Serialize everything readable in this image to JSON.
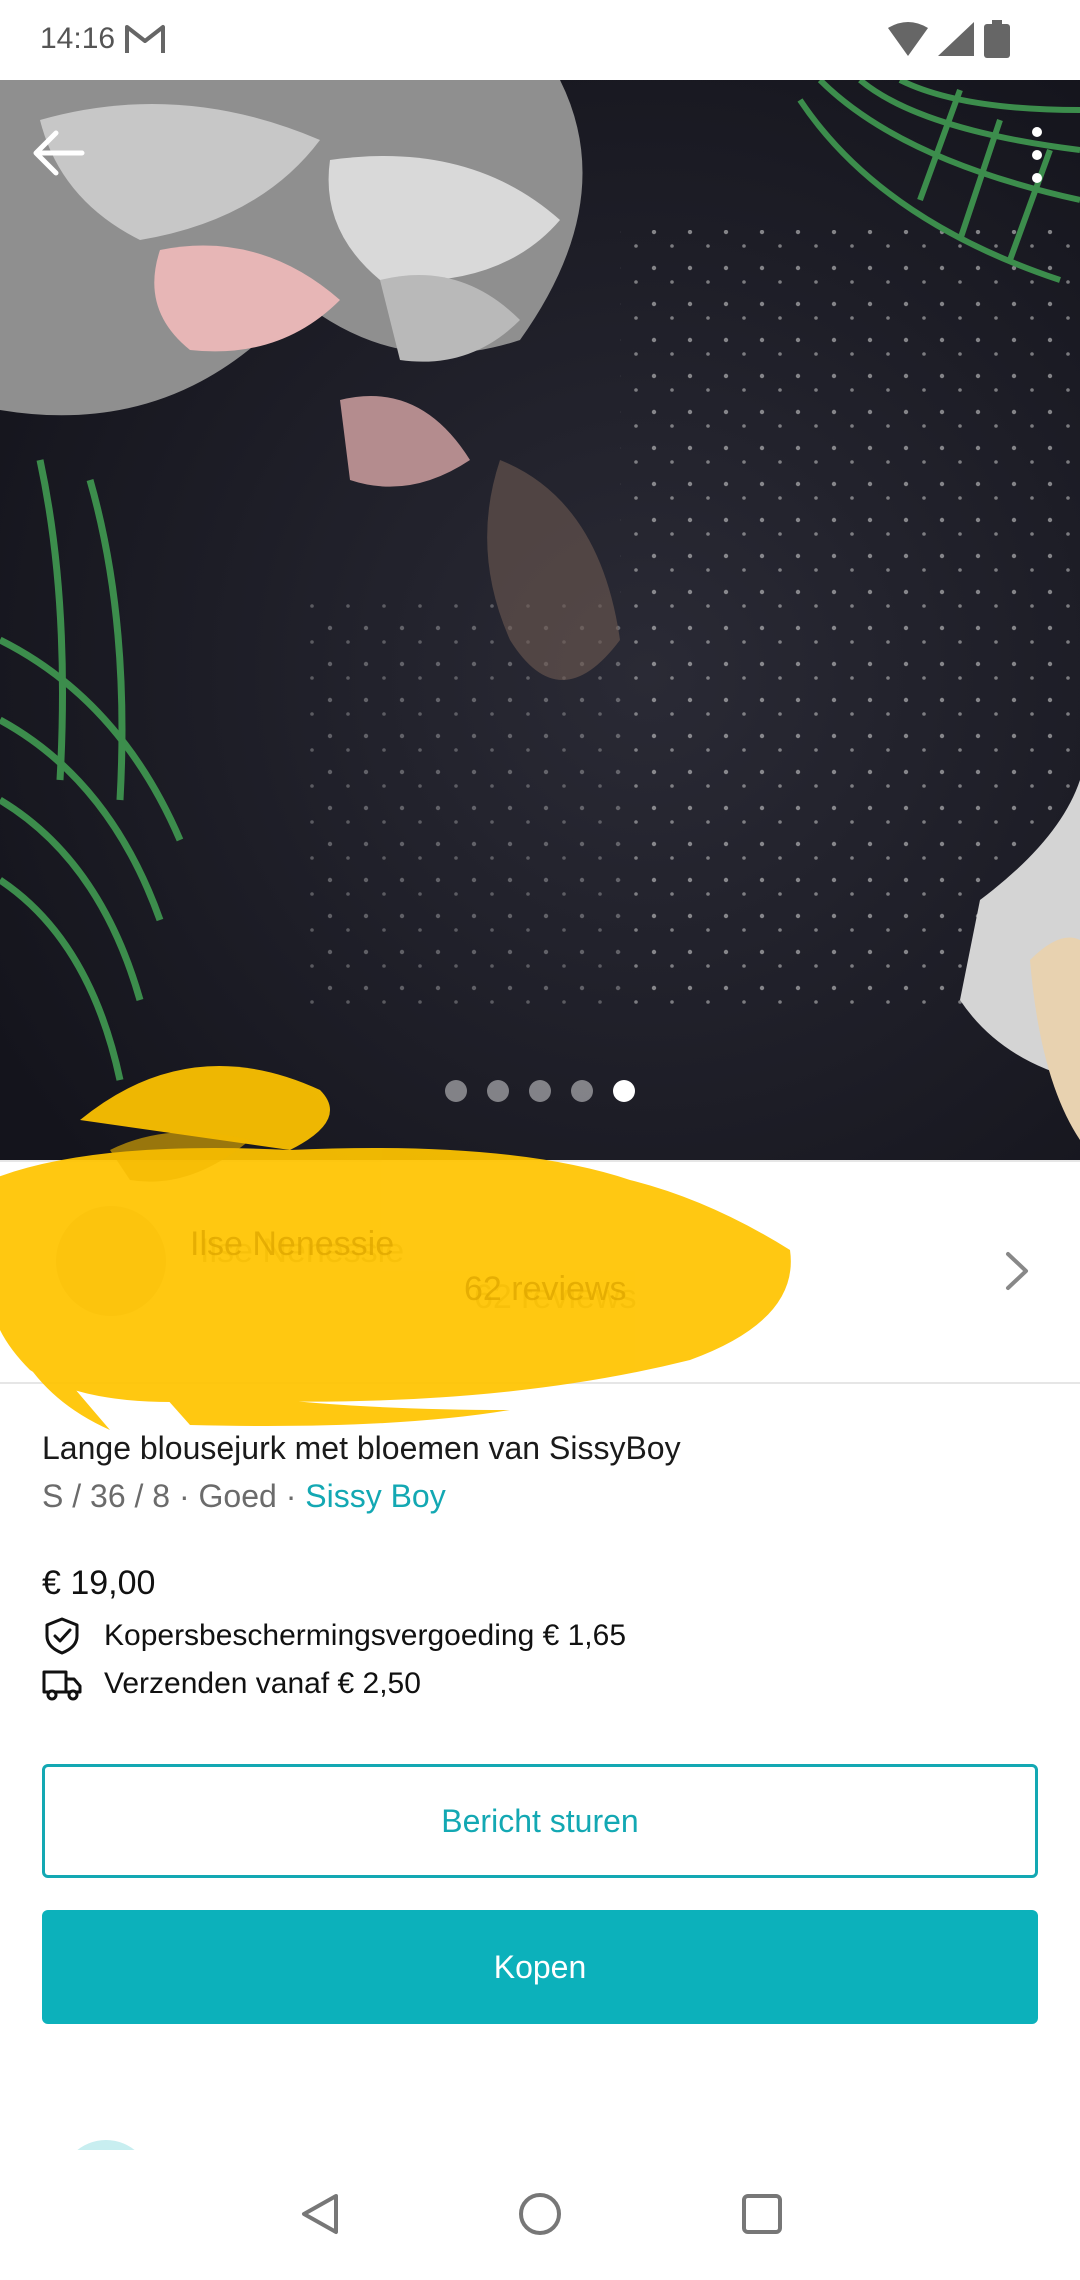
{
  "status_bar": {
    "time": "14:16"
  },
  "gallery": {
    "total_images": 5,
    "active_index": 5
  },
  "seller": {
    "name": "Ilse Nenessie",
    "reviews": "62 reviews"
  },
  "item": {
    "title": "Lange blousejurk met bloemen van SissyBoy",
    "meta_prefix": "S / 36 / 8 · Goed · ",
    "brand": "Sissy Boy",
    "price": "€ 19,00",
    "buyer_protection": "Kopersbeschermingsvergoeding € 1,65",
    "shipping": "Verzenden vanaf € 2,50"
  },
  "actions": {
    "message_label": "Bericht sturen",
    "buy_label": "Kopen"
  },
  "colors": {
    "accent": "#13a8b3",
    "buy_button": "#0cb1bb",
    "redaction": "#ffc400"
  }
}
